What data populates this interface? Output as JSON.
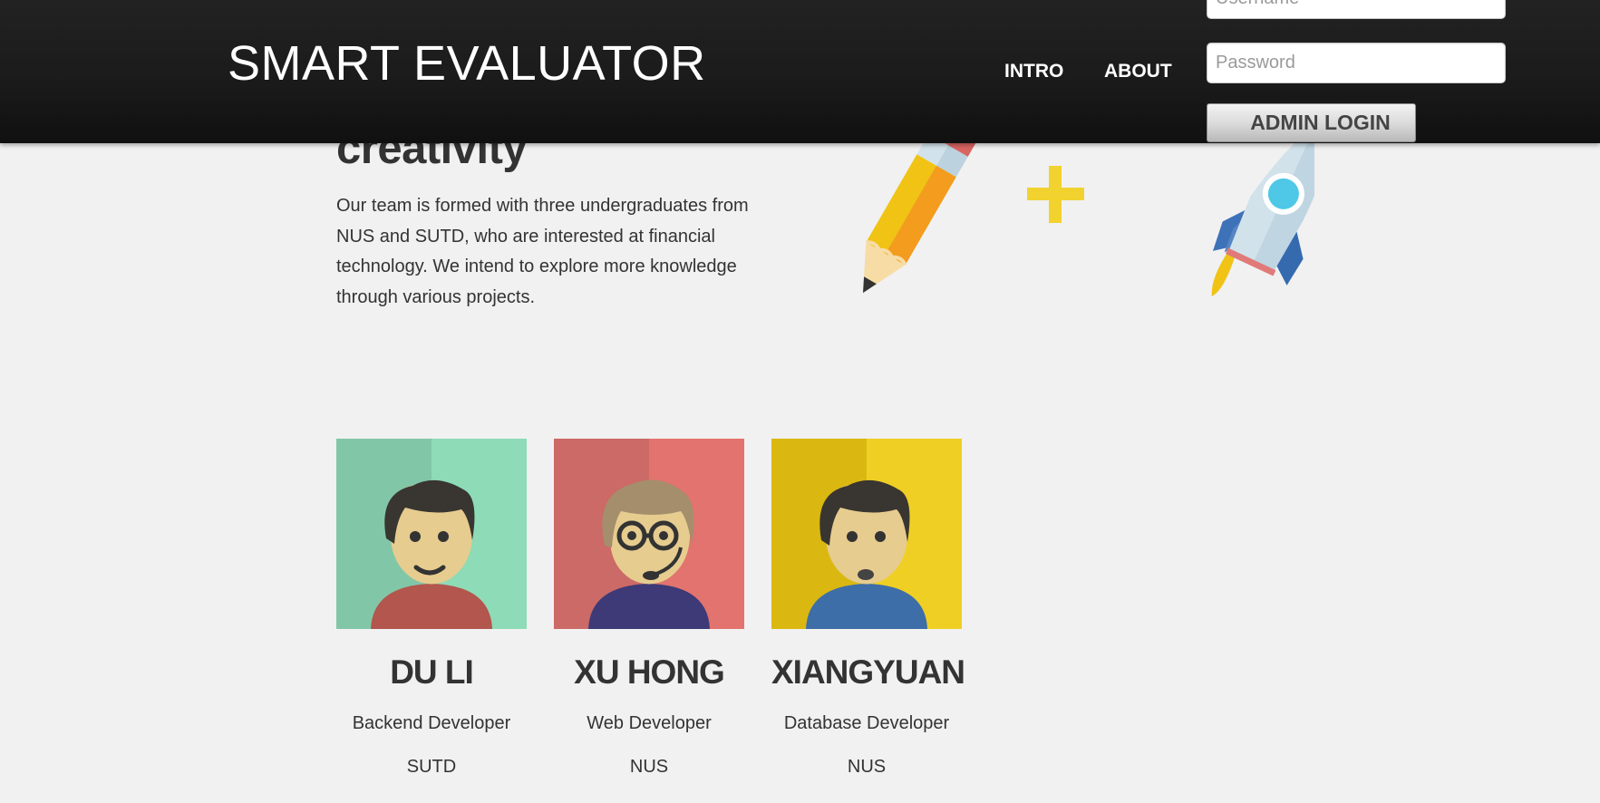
{
  "header": {
    "brand": "SMART EVALUATOR",
    "nav": [
      {
        "label": "INTRO"
      },
      {
        "label": "ABOUT"
      }
    ],
    "login": {
      "username_placeholder": "Username",
      "password_placeholder": "Password",
      "button_label": "ADMIN LOGIN"
    }
  },
  "intro": {
    "heading": "creativity",
    "text": "Our team is formed with three undergraduates from NUS and SUTD, who are interested at financial technology. We intend to explore more knowledge through various projects.",
    "illustration": [
      "pencil-icon",
      "plus-icon",
      "rocket-icon"
    ]
  },
  "team": [
    {
      "name": "DU LI",
      "role": "Backend Developer",
      "school": "SUTD",
      "avatar_icon": "person-smiling-icon",
      "bg_colors": [
        "#82c6a8",
        "#8ddbb7"
      ],
      "shirt_color": "#b3564e"
    },
    {
      "name": "XU HONG",
      "role": "Web Developer",
      "school": "NUS",
      "avatar_icon": "person-glasses-headset-icon",
      "bg_colors": [
        "#cb6a66",
        "#e3736e"
      ],
      "shirt_color": "#3d3a77"
    },
    {
      "name": "XIANGYUAN",
      "role": "Database Developer",
      "school": "NUS",
      "avatar_icon": "person-surprised-icon",
      "bg_colors": [
        "#dbb811",
        "#efcf24"
      ],
      "shirt_color": "#3e6ea8"
    }
  ],
  "colors": {
    "header_bg": "#1b1b1b",
    "page_bg": "#f1f1f1",
    "text": "#333333",
    "accent_plus": "#f2d22e"
  }
}
